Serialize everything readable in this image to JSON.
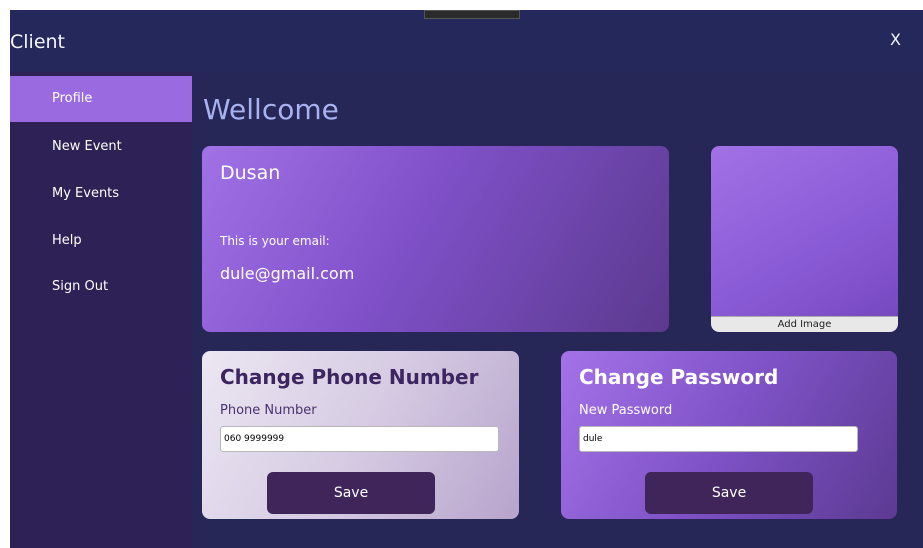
{
  "window": {
    "title": "Client",
    "close_label": "X"
  },
  "sidebar": {
    "items": [
      {
        "label": "Profile",
        "active": true
      },
      {
        "label": "New Event",
        "active": false
      },
      {
        "label": "My Events",
        "active": false
      },
      {
        "label": "Help",
        "active": false
      },
      {
        "label": "Sign Out",
        "active": false
      }
    ]
  },
  "main": {
    "heading": "Wellcome",
    "profile": {
      "name": "Dusan",
      "email_label": "This is your email:",
      "email": "dule@gmail.com"
    },
    "image_card": {
      "add_image_label": "Add Image"
    },
    "phone_card": {
      "title": "Change Phone Number",
      "field_label": "Phone Number",
      "value": "060 9999999",
      "save_label": "Save"
    },
    "password_card": {
      "title": "Change Password",
      "field_label": "New Password",
      "value": "dule",
      "save_label": "Save"
    }
  },
  "colors": {
    "background": "#262657",
    "sidebar": "#2e2155",
    "accent": "#9a6ae0",
    "button": "#40255a",
    "heading": "#a9b2f0"
  }
}
